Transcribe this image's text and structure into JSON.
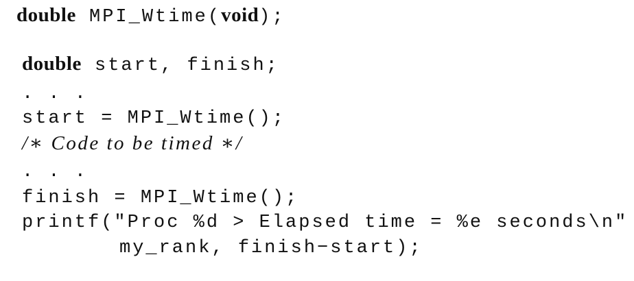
{
  "signature": {
    "return_type": "double",
    "function_name": "MPI_Wtime",
    "open_paren": "(",
    "param": "void",
    "close": ");"
  },
  "code": {
    "decl_type": "double",
    "decl_rest": " start, finish;",
    "ellipsis_1": ". . .",
    "start_assign": "start = MPI_Wtime();",
    "comment": "/∗ Code to be timed ∗/",
    "ellipsis_2": ". . .",
    "finish_assign": "finish = MPI_Wtime();",
    "printf_line": "printf(\"Proc %d > Elapsed time = %e seconds\\n\"",
    "printf_args": "my_rank, finish−start);"
  }
}
